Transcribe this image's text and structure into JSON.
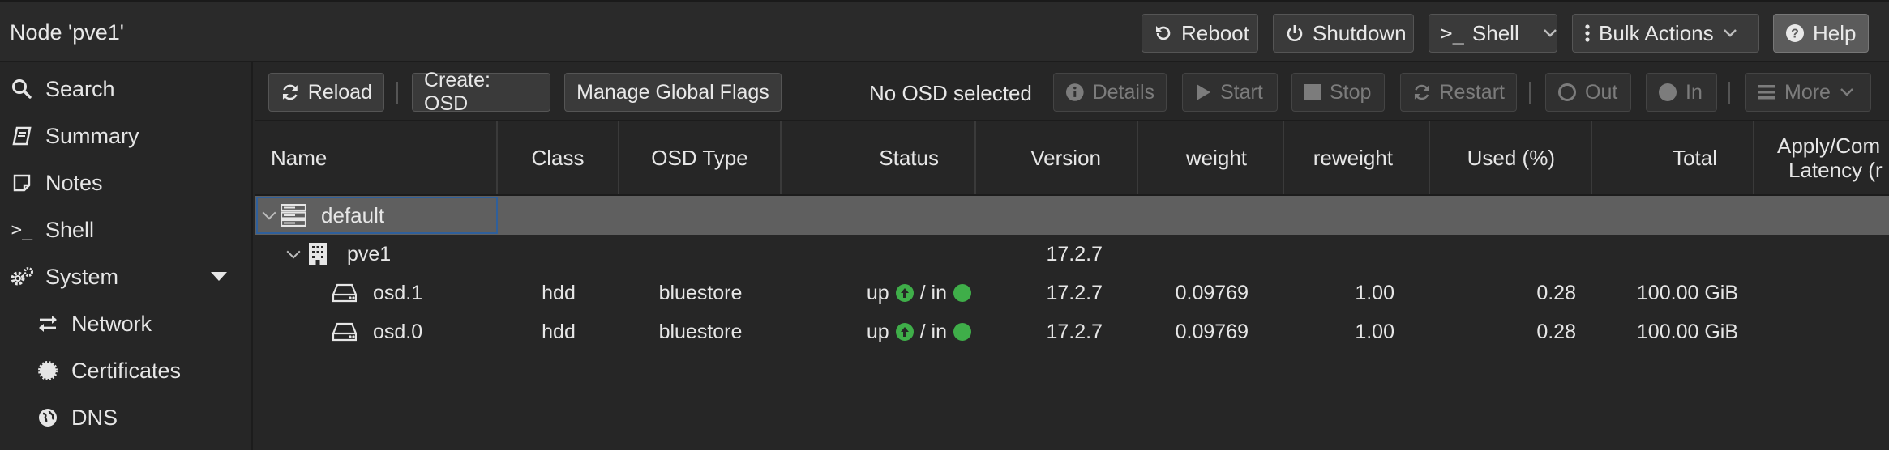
{
  "header": {
    "title": "Node 'pve1'",
    "buttons": {
      "reboot": "Reboot",
      "shutdown": "Shutdown",
      "shell": "Shell",
      "bulk": "Bulk Actions",
      "help": "Help"
    }
  },
  "sidebar": {
    "items": [
      {
        "label": "Search",
        "icon": "search-icon"
      },
      {
        "label": "Summary",
        "icon": "book-icon"
      },
      {
        "label": "Notes",
        "icon": "note-icon"
      },
      {
        "label": "Shell",
        "icon": "terminal-icon"
      },
      {
        "label": "System",
        "icon": "gears-icon"
      },
      {
        "label": "Network",
        "icon": "exchange-icon"
      },
      {
        "label": "Certificates",
        "icon": "certificate-icon"
      },
      {
        "label": "DNS",
        "icon": "globe-icon"
      }
    ]
  },
  "toolbar": {
    "reload": "Reload",
    "create_osd": "Create: OSD",
    "manage_flags": "Manage Global Flags",
    "no_selection": "No OSD selected",
    "details": "Details",
    "start": "Start",
    "stop": "Stop",
    "restart": "Restart",
    "out": "Out",
    "in": "In",
    "more": "More"
  },
  "grid": {
    "columns": {
      "name": "Name",
      "class": "Class",
      "osd_type": "OSD Type",
      "status": "Status",
      "version": "Version",
      "weight": "weight",
      "reweight": "reweight",
      "used": "Used (%)",
      "total": "Total",
      "latency_line1": "Apply/Com",
      "latency_line2": "Latency (r"
    },
    "rows": [
      {
        "name": "default"
      },
      {
        "name": "pve1",
        "version": "17.2.7"
      },
      {
        "name": "osd.1",
        "class": "hdd",
        "osd_type": "bluestore",
        "status_up": "up",
        "status_sep": "/ in",
        "version": "17.2.7",
        "weight": "0.09769",
        "reweight": "1.00",
        "used": "0.28",
        "total": "100.00 GiB"
      },
      {
        "name": "osd.0",
        "class": "hdd",
        "osd_type": "bluestore",
        "status_up": "up",
        "status_sep": "/ in",
        "version": "17.2.7",
        "weight": "0.09769",
        "reweight": "1.00",
        "used": "0.28",
        "total": "100.00 GiB"
      }
    ]
  },
  "colors": {
    "status_green": "#3fae49",
    "selection_row": "#5f5f5f",
    "selection_outline": "#2f5f9a"
  }
}
